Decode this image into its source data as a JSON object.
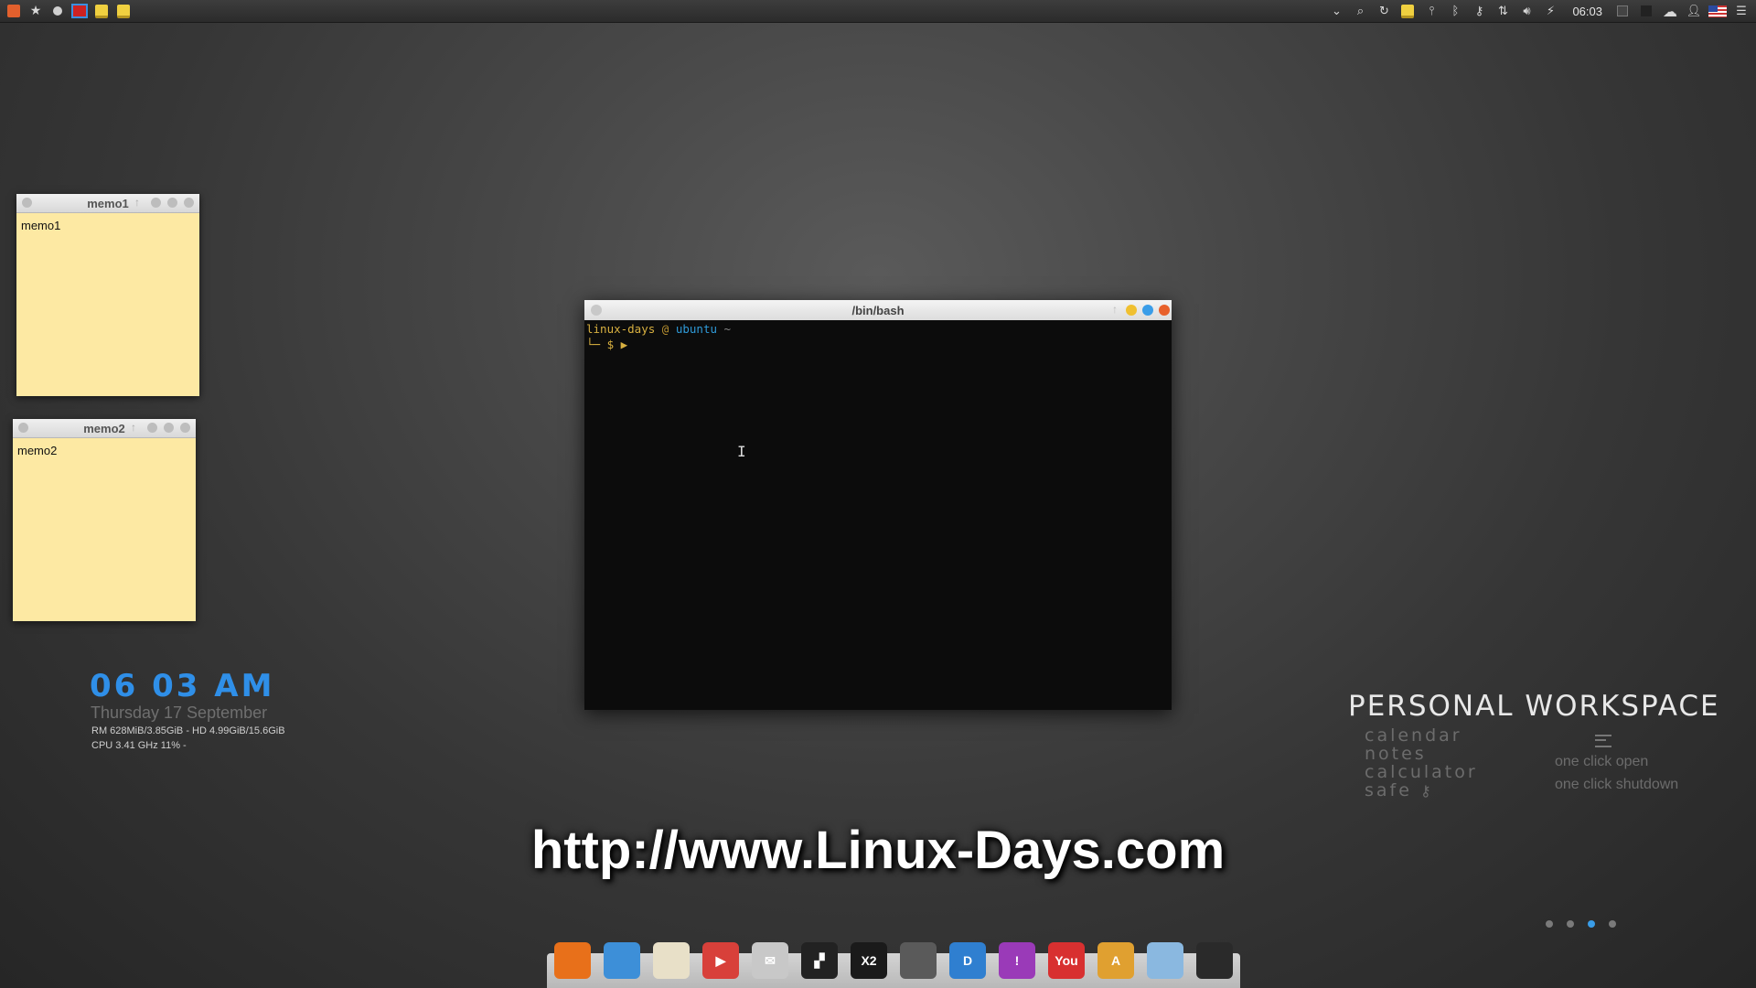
{
  "top_panel": {
    "left_icons": [
      "ubuntu-logo-icon",
      "star-icon",
      "record-icon",
      "terminal-icon",
      "note-icon",
      "note-icon"
    ],
    "right_icons": [
      "chevron-down-icon",
      "search-icon",
      "history-icon",
      "note-icon",
      "network-activity-icon",
      "bluetooth-icon",
      "key-icon",
      "transfer-icon",
      "volume-icon",
      "power-icon"
    ],
    "clock": "06:03",
    "extra_icons": [
      "workspace-icon",
      "cloud-icon",
      "user-icon",
      "us-flag-icon",
      "menu-icon"
    ]
  },
  "memo1": {
    "title": "memo1",
    "content": "memo1"
  },
  "memo2": {
    "title": "memo2",
    "content": "memo2"
  },
  "terminal": {
    "title": "/bin/bash",
    "user": "linux-days",
    "at": "@",
    "host": "ubuntu",
    "tilde": "~",
    "prompt": "└─ $ ▶"
  },
  "conky": {
    "time": "06 03 AM",
    "date": "Thursday 17 September",
    "line1": "RM 628MiB/3.85GiB - HD 4.99GiB/15.6GiB",
    "line2": "CPU 3.41 GHz 11% -"
  },
  "workspace": {
    "title": "PERSONAL WORKSPACE",
    "items": [
      "calendar",
      "notes",
      "calculator",
      "safe"
    ],
    "one_click_open": "one click open",
    "one_click_shutdown": "one click shutdown"
  },
  "banner": {
    "url": "http://www.Linux-Days.com"
  },
  "pager": {
    "count": 4,
    "active_index": 2
  },
  "dock": {
    "items": [
      {
        "name": "firefox-icon",
        "glyph": "",
        "color": "#e8701a"
      },
      {
        "name": "contacts-icon",
        "glyph": "",
        "color": "#3d8fd8"
      },
      {
        "name": "notes-icon",
        "glyph": "",
        "color": "#e8e0c8"
      },
      {
        "name": "presentation-icon",
        "glyph": "▶",
        "color": "#d8403a"
      },
      {
        "name": "mail-icon",
        "glyph": "✉",
        "color": "#c8c8c8"
      },
      {
        "name": "layout-icon",
        "glyph": "▞",
        "color": "#222222"
      },
      {
        "name": "x2-icon",
        "glyph": "X2",
        "color": "#1a1a1a"
      },
      {
        "name": "rocket-icon",
        "glyph": "",
        "color": "#5a5a5a"
      },
      {
        "name": "document-d-icon",
        "glyph": "D",
        "color": "#2f7fd0"
      },
      {
        "name": "chat-icon",
        "glyph": "!",
        "color": "#9a3ab8"
      },
      {
        "name": "youtube-icon",
        "glyph": "You",
        "color": "#d83030"
      },
      {
        "name": "software-center-icon",
        "glyph": "A",
        "color": "#e0a030"
      },
      {
        "name": "remote-icon",
        "glyph": "",
        "color": "#8ab8e0"
      },
      {
        "name": "file-manager-icon",
        "glyph": "",
        "color": "#2a2a2a"
      }
    ]
  }
}
